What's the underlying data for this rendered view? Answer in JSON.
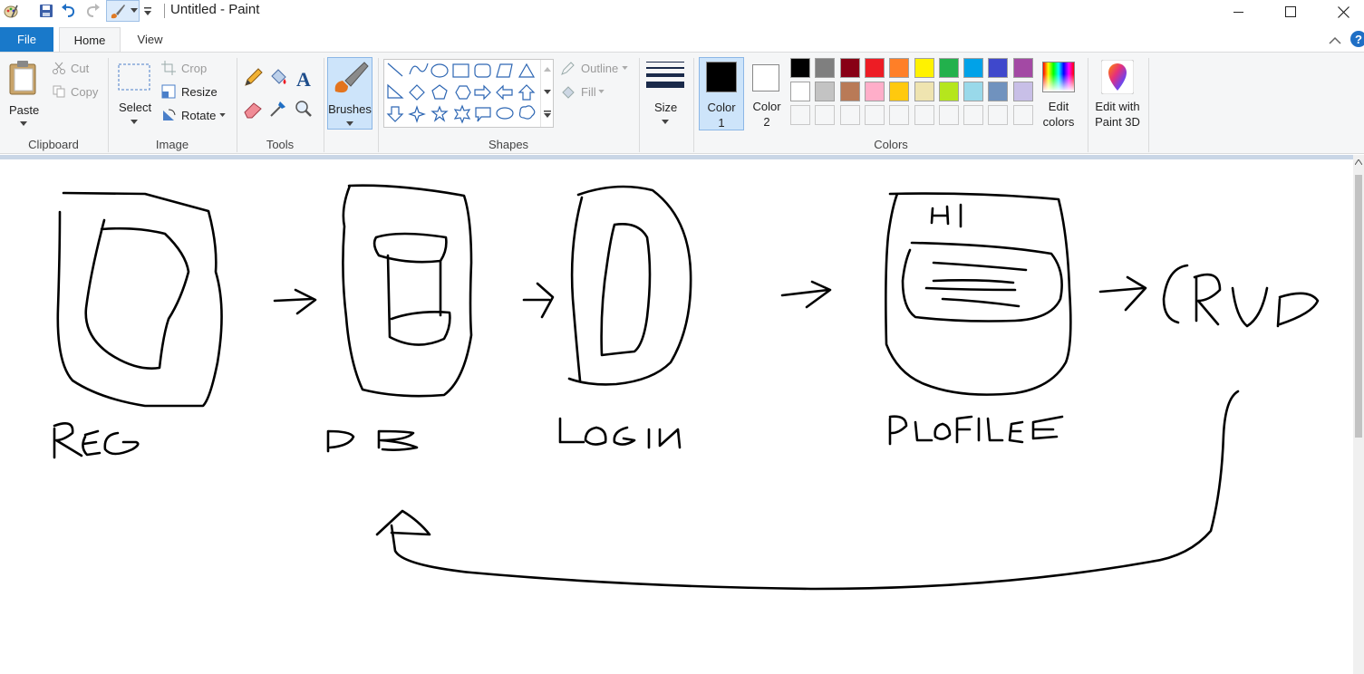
{
  "window": {
    "title": "Untitled - Paint"
  },
  "tabs": {
    "file": "File",
    "home": "Home",
    "view": "View"
  },
  "clipboard": {
    "paste": "Paste",
    "cut": "Cut",
    "copy": "Copy",
    "group": "Clipboard"
  },
  "image": {
    "select": "Select",
    "crop": "Crop",
    "resize": "Resize",
    "rotate": "Rotate",
    "group": "Image"
  },
  "tools": {
    "group": "Tools"
  },
  "brushes": {
    "label": "Brushes"
  },
  "shapes": {
    "outline": "Outline",
    "fill": "Fill",
    "group": "Shapes"
  },
  "size": {
    "label": "Size"
  },
  "colors": {
    "color1_label": "Color",
    "color1_num": "1",
    "color2_label": "Color",
    "color2_num": "2",
    "group": "Colors",
    "edit_colors_1": "Edit",
    "edit_colors_2": "colors",
    "color1_value": "#000000",
    "color2_value": "#ffffff",
    "palette_row1": [
      "#000000",
      "#7f7f7f",
      "#880015",
      "#ed1c24",
      "#ff7f27",
      "#fff200",
      "#22b14c",
      "#00a2e8",
      "#3f48cc",
      "#a349a4"
    ],
    "palette_row2": [
      "#ffffff",
      "#c3c3c3",
      "#b97a57",
      "#ffaec9",
      "#ffc90e",
      "#efe4b0",
      "#b5e61d",
      "#99d9ea",
      "#7092be",
      "#c8bfe7"
    ]
  },
  "paint3d": {
    "line1": "Edit with",
    "line2": "Paint 3D"
  }
}
